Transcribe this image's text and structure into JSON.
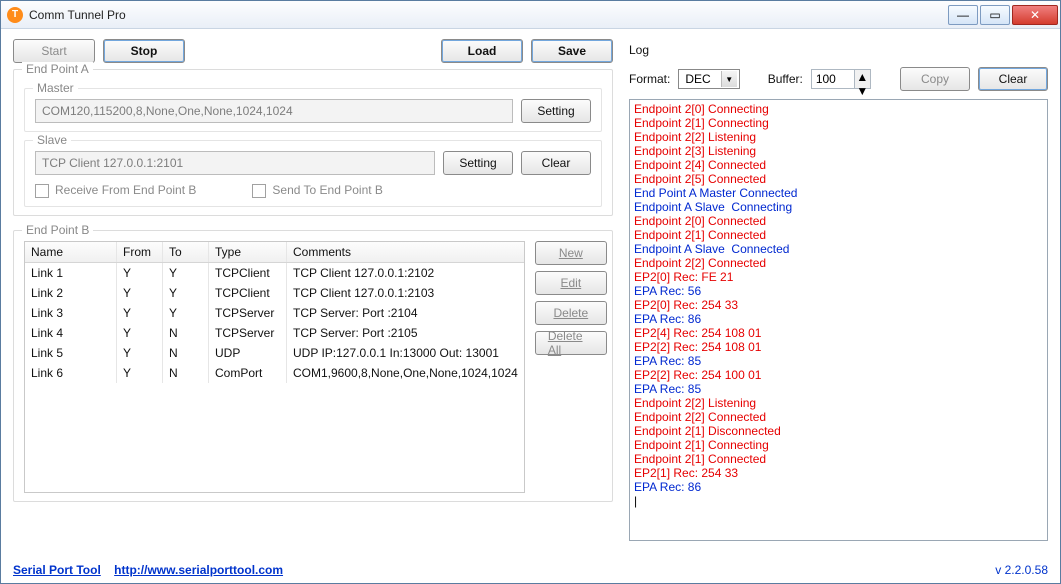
{
  "window": {
    "title": "Comm Tunnel Pro"
  },
  "toolbar": {
    "start": "Start",
    "stop": "Stop",
    "load": "Load",
    "save": "Save"
  },
  "epa": {
    "legend": "End Point A",
    "master": {
      "legend": "Master",
      "value": "COM120,115200,8,None,One,None,1024,1024",
      "setting": "Setting"
    },
    "slave": {
      "legend": "Slave",
      "value": "TCP Client 127.0.0.1:2101",
      "setting": "Setting",
      "clear": "Clear",
      "recv_label": "Receive From End Point B",
      "send_label": "Send  To End Point B"
    }
  },
  "epb": {
    "legend": "End Point B",
    "headers": {
      "name": "Name",
      "from": "From",
      "to": "To",
      "type": "Type",
      "comments": "Comments"
    },
    "rows": [
      {
        "name": "Link 1",
        "from": "Y",
        "to": "Y",
        "type": "TCPClient",
        "comments": "TCP Client 127.0.0.1:2102"
      },
      {
        "name": "Link 2",
        "from": "Y",
        "to": "Y",
        "type": "TCPClient",
        "comments": "TCP Client 127.0.0.1:2103"
      },
      {
        "name": "Link 3",
        "from": "Y",
        "to": "Y",
        "type": "TCPServer",
        "comments": "TCP Server: Port :2104"
      },
      {
        "name": "Link 4",
        "from": "Y",
        "to": "N",
        "type": "TCPServer",
        "comments": "TCP Server: Port :2105"
      },
      {
        "name": "Link 5",
        "from": "Y",
        "to": "N",
        "type": "UDP",
        "comments": "UDP IP:127.0.0.1 In:13000 Out: 13001"
      },
      {
        "name": "Link 6",
        "from": "Y",
        "to": "N",
        "type": "ComPort",
        "comments": "COM1,9600,8,None,One,None,1024,1024"
      }
    ],
    "btn_new": "New",
    "btn_edit": "Edit",
    "btn_delete": "Delete",
    "btn_delete_all": "Delete All"
  },
  "log": {
    "title": "Log",
    "format_label": "Format:",
    "format_value": "DEC",
    "buffer_label": "Buffer:",
    "buffer_value": "100",
    "copy": "Copy",
    "clear": "Clear",
    "lines": [
      {
        "c": "red",
        "t": "Endpoint 2[0] Connecting"
      },
      {
        "c": "red",
        "t": "Endpoint 2[1] Connecting"
      },
      {
        "c": "red",
        "t": "Endpoint 2[2] Listening"
      },
      {
        "c": "red",
        "t": "Endpoint 2[3] Listening"
      },
      {
        "c": "red",
        "t": "Endpoint 2[4] Connected"
      },
      {
        "c": "red",
        "t": "Endpoint 2[5] Connected"
      },
      {
        "c": "blue",
        "t": "End Point A Master Connected"
      },
      {
        "c": "blue",
        "t": "Endpoint A Slave  Connecting"
      },
      {
        "c": "red",
        "t": "Endpoint 2[0] Connected"
      },
      {
        "c": "red",
        "t": "Endpoint 2[1] Connected"
      },
      {
        "c": "blue",
        "t": "Endpoint A Slave  Connected"
      },
      {
        "c": "red",
        "t": "Endpoint 2[2] Connected"
      },
      {
        "c": "red",
        "t": "EP2[0] Rec: FE 21"
      },
      {
        "c": "blue",
        "t": "EPA Rec: 56"
      },
      {
        "c": "red",
        "t": "EP2[0] Rec: 254 33"
      },
      {
        "c": "blue",
        "t": "EPA Rec: 86"
      },
      {
        "c": "red",
        "t": "EP2[4] Rec: 254 108 01"
      },
      {
        "c": "red",
        "t": "EP2[2] Rec: 254 108 01"
      },
      {
        "c": "blue",
        "t": "EPA Rec: 85"
      },
      {
        "c": "red",
        "t": "EP2[2] Rec: 254 100 01"
      },
      {
        "c": "blue",
        "t": "EPA Rec: 85"
      },
      {
        "c": "red",
        "t": "Endpoint 2[2] Listening"
      },
      {
        "c": "red",
        "t": "Endpoint 2[2] Connected"
      },
      {
        "c": "red",
        "t": "Endpoint 2[1] Disconnected"
      },
      {
        "c": "red",
        "t": "Endpoint 2[1] Connecting"
      },
      {
        "c": "red",
        "t": "Endpoint 2[1] Connected"
      },
      {
        "c": "red",
        "t": "EP2[1] Rec: 254 33"
      },
      {
        "c": "blue",
        "t": "EPA Rec: 86"
      }
    ]
  },
  "footer": {
    "link1": "Serial Port Tool",
    "link2": "http://www.serialporttool.com",
    "version": "v 2.2.0.58"
  }
}
